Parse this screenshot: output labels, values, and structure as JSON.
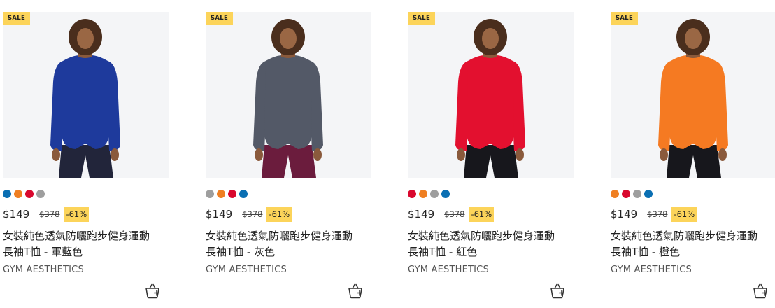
{
  "products": [
    {
      "badge": "SALE",
      "shirt_color": "#1e3a9c",
      "pants_color": "#22253a",
      "swatches": [
        "#0a6fb3",
        "#ef7f22",
        "#d9082e",
        "#9e9e9e"
      ],
      "price": "$149",
      "original_price": "$378",
      "discount": "-61%",
      "title_line1": "女裝純色透氣防曬跑步健身運動",
      "title_line2": "長袖T恤 - 軍藍色",
      "brand": "GYM AESTHETICS"
    },
    {
      "badge": "SALE",
      "shirt_color": "#535967",
      "pants_color": "#6b1c3d",
      "swatches": [
        "#9e9e9e",
        "#ef7f22",
        "#d9082e",
        "#0a6fb3"
      ],
      "price": "$149",
      "original_price": "$378",
      "discount": "-61%",
      "title_line1": "女裝純色透氣防曬跑步健身運動",
      "title_line2": "長袖T恤 - 灰色",
      "brand": "GYM AESTHETICS"
    },
    {
      "badge": "SALE",
      "shirt_color": "#e3102f",
      "pants_color": "#17171c",
      "swatches": [
        "#d9082e",
        "#ef7f22",
        "#9e9e9e",
        "#0a6fb3"
      ],
      "price": "$149",
      "original_price": "$378",
      "discount": "-61%",
      "title_line1": "女裝純色透氣防曬跑步健身運動",
      "title_line2": "長袖T恤 - 紅色",
      "brand": "GYM AESTHETICS"
    },
    {
      "badge": "SALE",
      "shirt_color": "#f57a22",
      "pants_color": "#17171c",
      "swatches": [
        "#ef7f22",
        "#d9082e",
        "#9e9e9e",
        "#0a6fb3"
      ],
      "price": "$149",
      "original_price": "$378",
      "discount": "-61%",
      "title_line1": "女裝純色透氣防曬跑步健身運動",
      "title_line2": "長袖T恤 - 橙色",
      "brand": "GYM AESTHETICS"
    }
  ],
  "icons": {
    "cart": "add-to-cart-basket-icon"
  },
  "accent_color": "#fcd45a"
}
